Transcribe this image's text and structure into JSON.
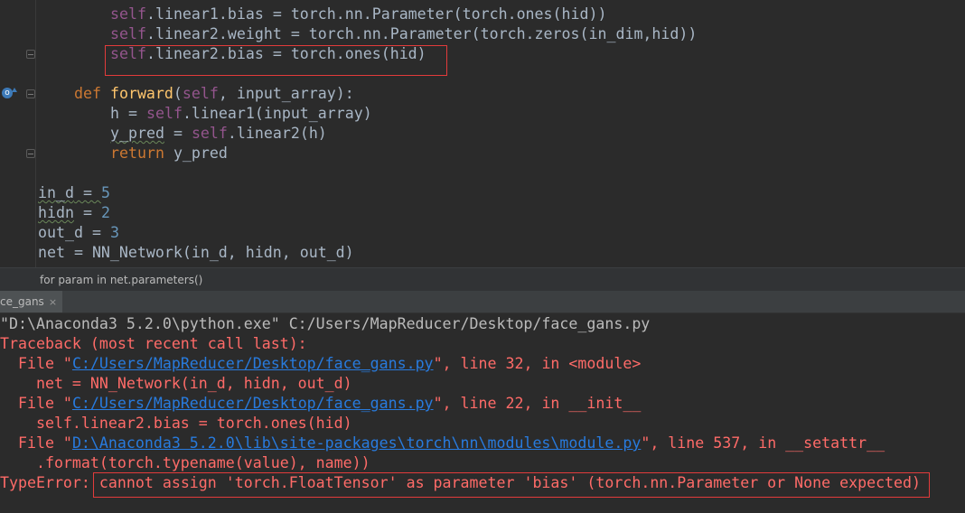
{
  "editor": {
    "lines": {
      "l0_a": "self",
      "l0_b": ".linear1.bias = torch.nn.Parameter(torch.ones(hid))",
      "l1_a": "self",
      "l1_b": ".linear2.weight = torch.nn.Parameter(torch.zeros(in_dim,hid))",
      "l2_a": "self",
      "l2_b": ".linear2.bias = torch.ones(hid)",
      "l3_def": "def ",
      "l3_fn": "forward",
      "l3_open": "(",
      "l3_self": "self",
      "l3_rest": ", input_array):",
      "l4_a": "h = ",
      "l4_self": "self",
      "l4_b": ".linear1(input_array)",
      "l5_a": "y_pred",
      "l5_b": " = ",
      "l5_self": "self",
      "l5_c": ".linear2(h)",
      "l6_kw": "return",
      "l6_b": " y_pred",
      "l7_a": "in_d",
      "l7_b": " = ",
      "l7_num": "5",
      "l8_a": "hidn",
      "l8_b": " = ",
      "l8_num": "2",
      "l9_a": "out_d = ",
      "l9_num": "3",
      "l10": "net = NN_Network(in_d, hidn, out_d)"
    },
    "breadcrumb_hint": "for param in net.parameters()"
  },
  "run_tab": {
    "label": "ce_gans",
    "close": "×"
  },
  "console": {
    "cmd": "\"D:\\Anaconda3 5.2.0\\python.exe\" C:/Users/MapReducer/Desktop/face_gans.py",
    "traceback": "Traceback (most recent call last):",
    "frames": [
      {
        "prefix": "  File \"",
        "path": "C:/Users/MapReducer/Desktop/face_gans.py",
        "suffix": "\", line 32, in <module>",
        "code": "    net = NN_Network(in_d, hidn, out_d)"
      },
      {
        "prefix": "  File \"",
        "path": "C:/Users/MapReducer/Desktop/face_gans.py",
        "suffix": "\", line 22, in __init__",
        "code": "    self.linear2.bias = torch.ones(hid)"
      },
      {
        "prefix": "  File \"",
        "path": "D:\\Anaconda3 5.2.0\\lib\\site-packages\\torch\\nn\\modules\\module.py",
        "suffix": "\", line 537, in __setattr__",
        "code": "    .format(torch.typename(value), name))"
      }
    ],
    "error_type": "TypeError: ",
    "error_msg": "cannot assign 'torch.FloatTensor' as parameter 'bias' (torch.nn.Parameter or None expected)"
  },
  "colors": {
    "editor_bg": "#2b2b2b",
    "error_red": "#ff6b68",
    "link_blue": "#287bde",
    "highlight_box": "#e23b3b"
  }
}
